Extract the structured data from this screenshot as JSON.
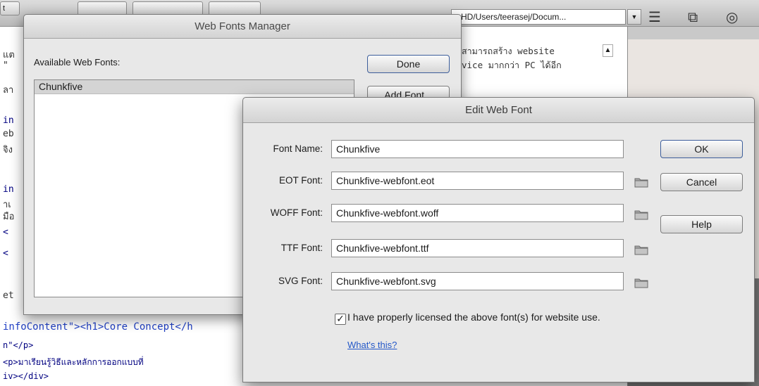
{
  "toolbar": {
    "path": "n HD/Users/teerasej/Docum...",
    "tab_fragment": "t"
  },
  "code": {
    "lines": [
      {
        "text": "แต",
        "extra": ""
      },
      {
        "text": "  \"",
        "extra": ""
      },
      {
        "text": "ลา",
        "extra": ""
      },
      {
        "text": "in",
        "extra": ""
      },
      {
        "text": "eb",
        "extra": ""
      },
      {
        "text": "จิง",
        "extra": ""
      },
      {
        "text": "in",
        "extra": ""
      },
      {
        "text": "าเ",
        "extra": ""
      },
      {
        "text": "มือ",
        "extra": ""
      },
      {
        "text": "  <",
        "extra": ""
      },
      {
        "text": "  <",
        "extra": ""
      },
      {
        "text": "et",
        "extra": ""
      }
    ],
    "right_text_1": "สามารถสร้าง website",
    "right_text_2": "vice มากกว่า PC ได้อีก",
    "bottom_1": "infoContent\"><h1>Core Concept</h",
    "bottom_2": "n\"</p>",
    "bottom_3": "   <p>มาเรียนรู้วิธีและหลักการออกแบบที่",
    "bottom_4": "iv></div>"
  },
  "web_fonts_manager": {
    "title": "Web Fonts Manager",
    "available_label": "Available Web Fonts:",
    "fonts": [
      "Chunkfive"
    ],
    "done_label": "Done",
    "add_font_label": "Add Font..."
  },
  "edit_web_font": {
    "title": "Edit Web Font",
    "fields": [
      {
        "label": "Font Name:",
        "value": "Chunkfive"
      },
      {
        "label": "EOT Font:",
        "value": "Chunkfive-webfont.eot"
      },
      {
        "label": "WOFF Font:",
        "value": "Chunkfive-webfont.woff"
      },
      {
        "label": "TTF Font:",
        "value": "Chunkfive-webfont.ttf"
      },
      {
        "label": "SVG Font:",
        "value": "Chunkfive-webfont.svg"
      }
    ],
    "ok_label": "OK",
    "cancel_label": "Cancel",
    "help_label": "Help",
    "license_checked": true,
    "license_text": "I have properly licensed the above font(s) for website use.",
    "whats_this": "What's this?"
  }
}
